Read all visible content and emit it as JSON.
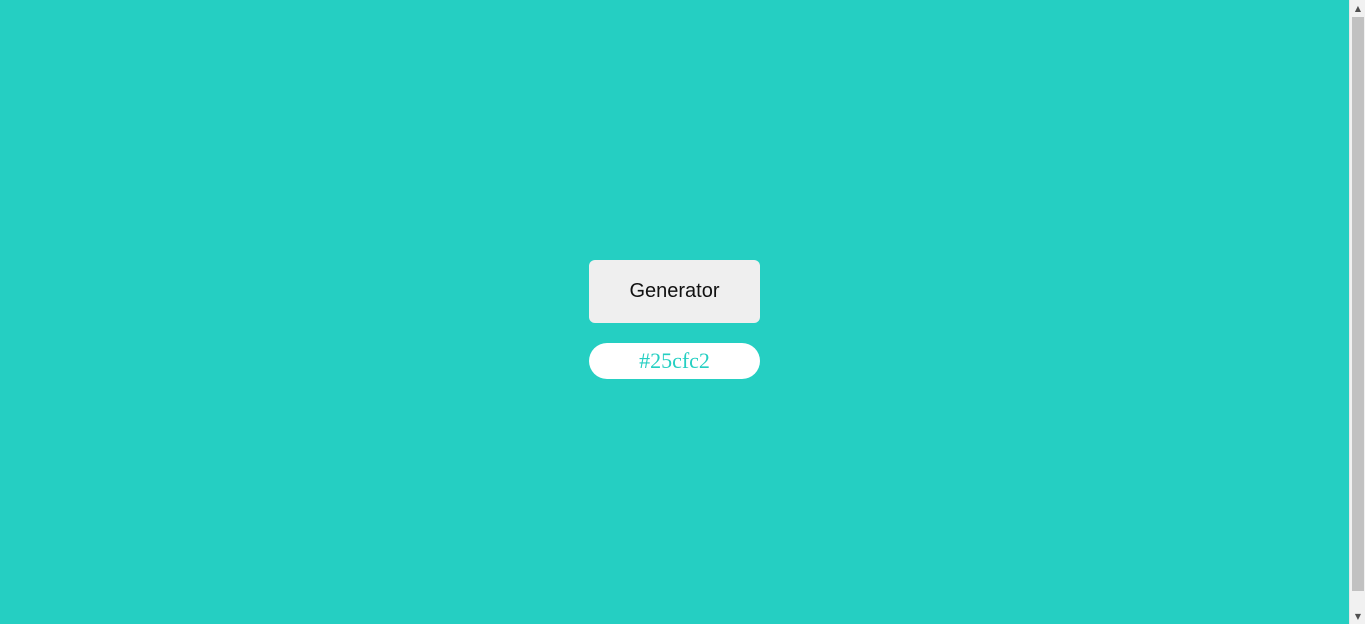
{
  "generator": {
    "label": "Generator"
  },
  "color_display": {
    "value": "#25cfc2"
  },
  "scrollbar": {
    "up_icon": "triangle-up-icon",
    "down_icon": "triangle-down-icon"
  },
  "colors": {
    "background": "#25cfc2",
    "button_bg": "#efefef",
    "display_bg": "#ffffff",
    "display_text": "#25cfc2"
  }
}
